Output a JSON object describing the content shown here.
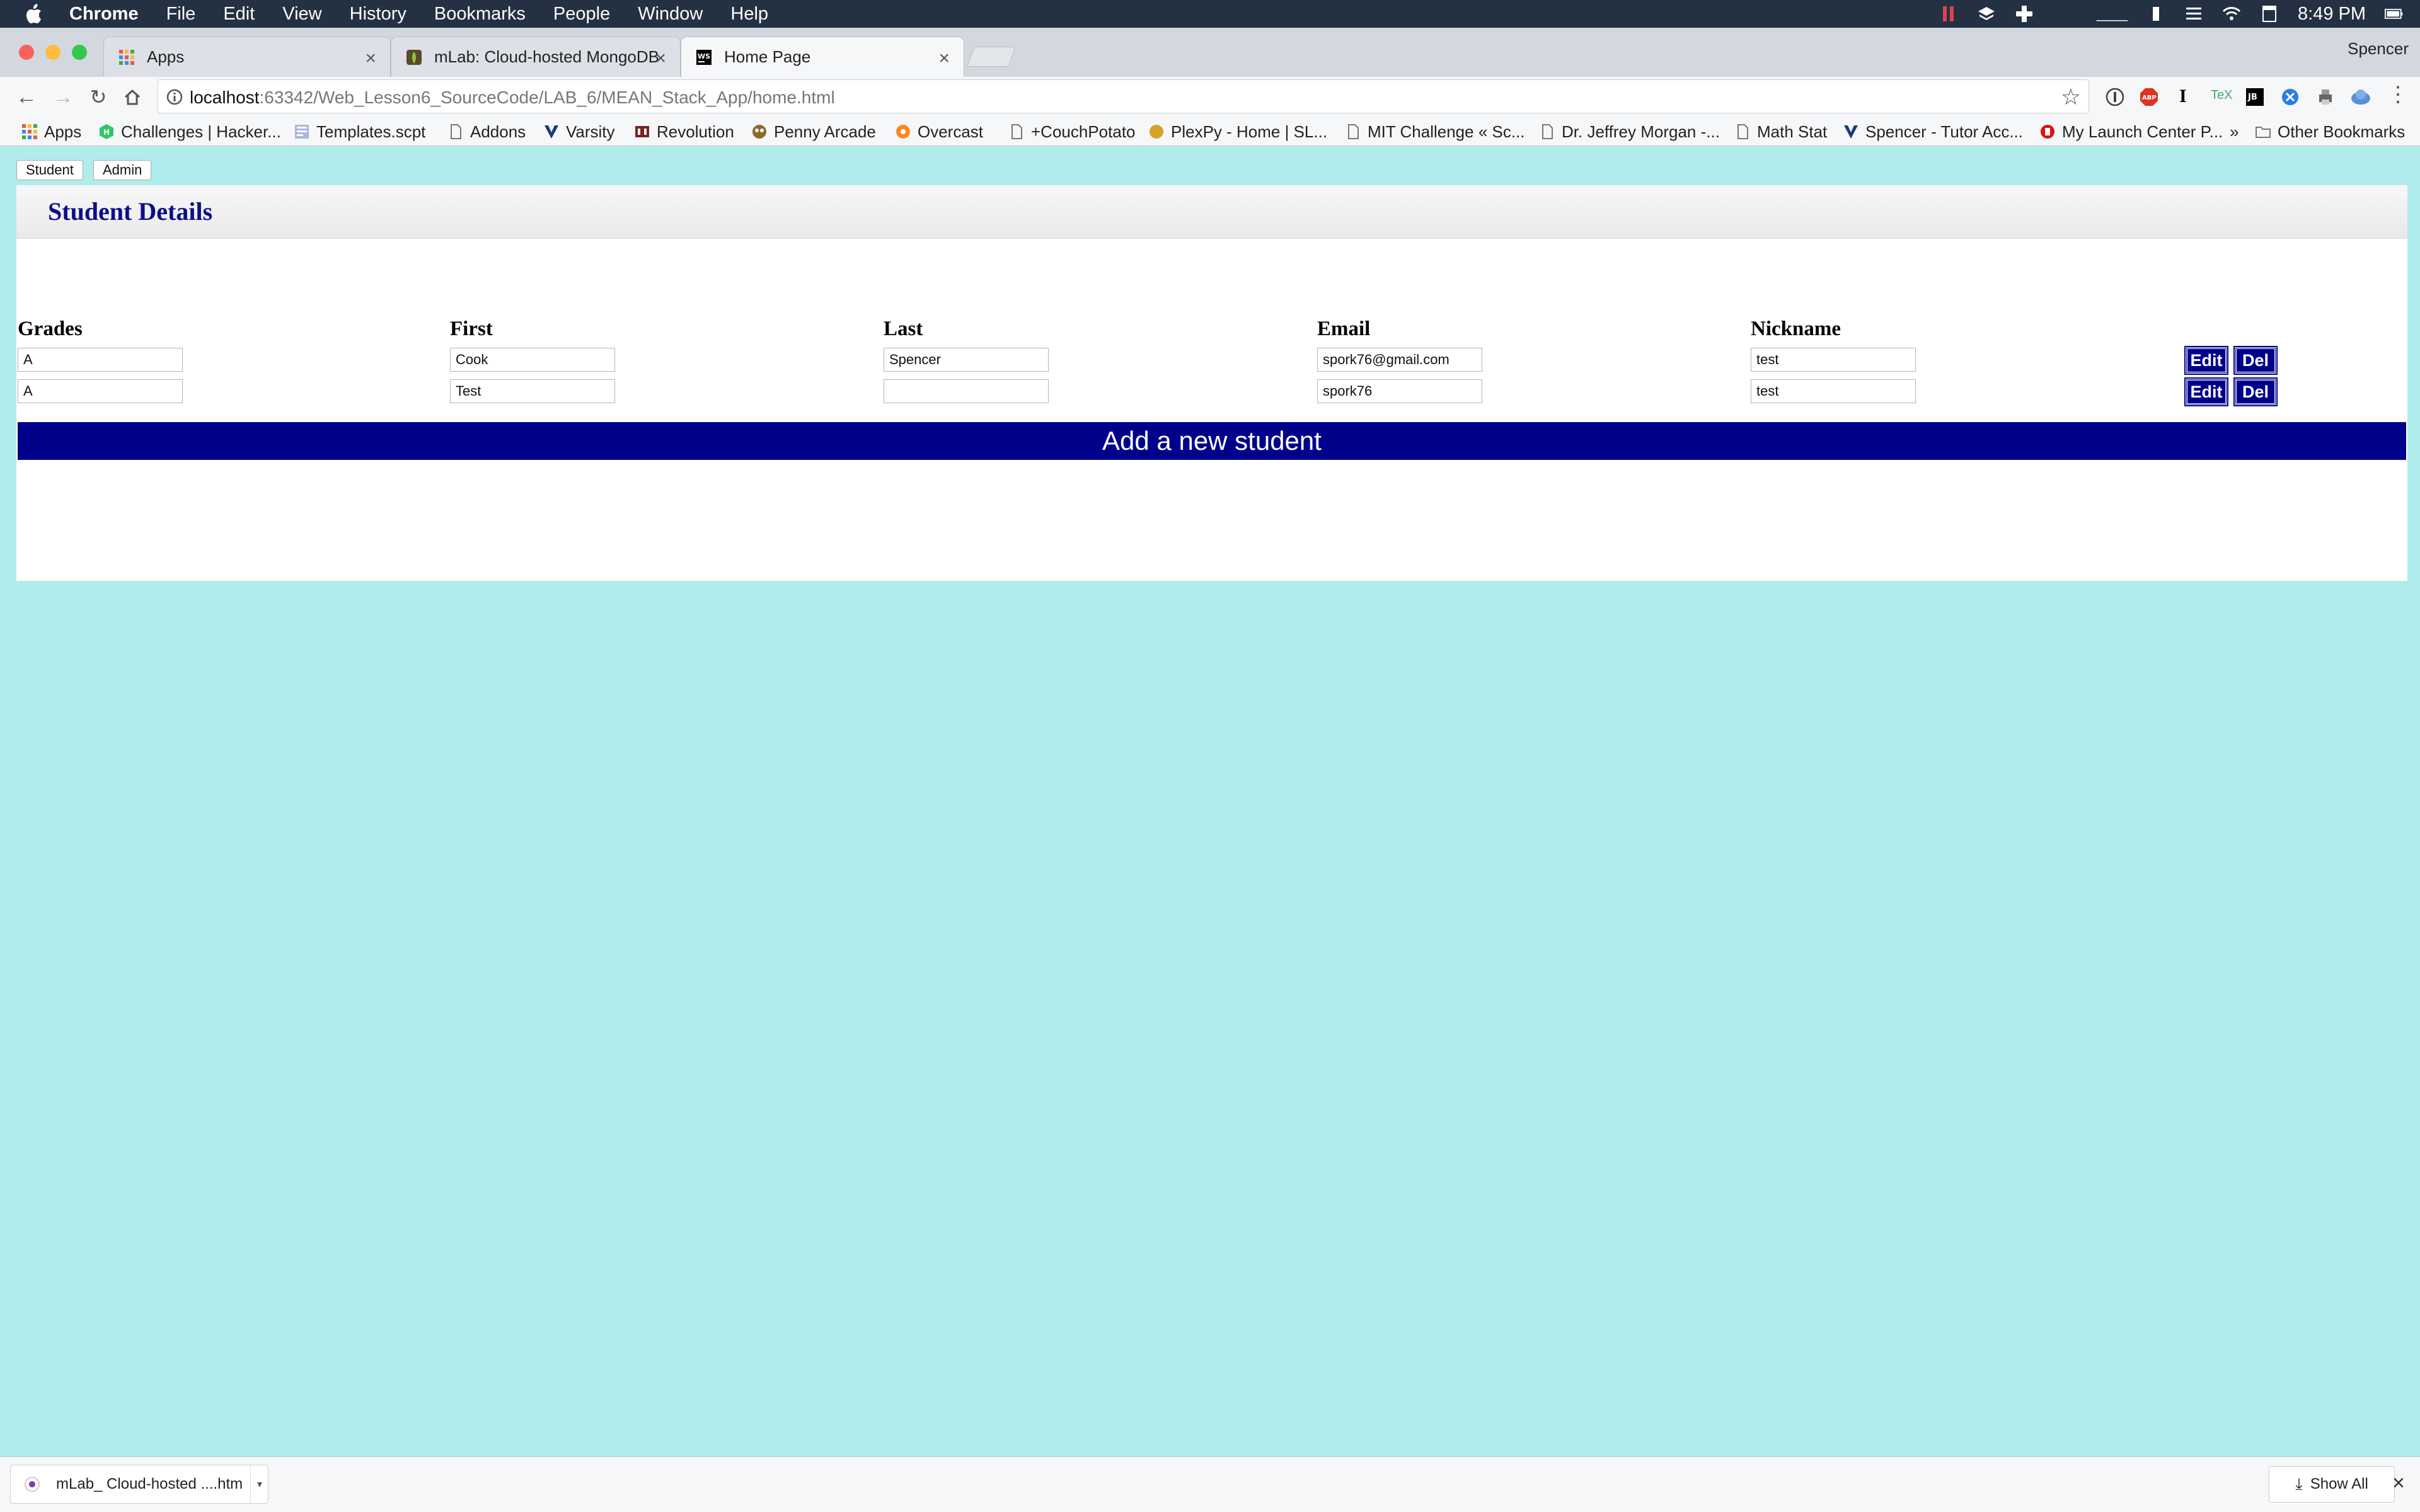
{
  "menubar": {
    "app": "Chrome",
    "items": [
      "File",
      "Edit",
      "View",
      "History",
      "Bookmarks",
      "People",
      "Window",
      "Help"
    ],
    "time": "8:49 PM",
    "status_icons": [
      "pause-icon",
      "layers-icon",
      "plus-cross-icon",
      "battery-icon",
      "wifi-icon",
      "calendar-icon",
      "battery-full-icon"
    ]
  },
  "tabs": [
    {
      "label": "Apps",
      "icon": "apps-grid-icon",
      "active": false
    },
    {
      "label": "mLab: Cloud-hosted MongoDB",
      "icon": "mlab-icon",
      "active": false
    },
    {
      "label": "Home Page",
      "icon": "webstorm-icon",
      "active": true
    }
  ],
  "profile": "Spencer",
  "url": {
    "host": "localhost",
    "path": ":63342/Web_Lesson6_SourceCode/LAB_6/MEAN_Stack_App/home.html"
  },
  "bookmarks": [
    "Apps",
    "Challenges | Hacker...",
    "Templates.scpt",
    "Addons",
    "Varsity",
    "Revolution",
    "Penny Arcade",
    "Overcast",
    "+CouchPotato",
    "PlexPy - Home | SL...",
    "MIT Challenge « Sc...",
    "Dr. Jeffrey Morgan -...",
    "Math Stat",
    "Spencer - Tutor Acc...",
    "My Launch Center P..."
  ],
  "bookmarks_more": "»",
  "bookmarks_other": "Other Bookmarks",
  "nav": {
    "student": "Student",
    "admin": "Admin"
  },
  "card_title": "Student Details",
  "columns": [
    "Grades",
    "First",
    "Last",
    "Email",
    "Nickname"
  ],
  "rows": [
    [
      "A",
      "Cook",
      "Spencer",
      "spork76@gmail.com",
      "test"
    ],
    [
      "A",
      "Test",
      "",
      "spork76",
      "test"
    ]
  ],
  "actions": {
    "edit": "Edit",
    "del": "Del"
  },
  "add_button": "Add a new student",
  "download": {
    "file": "mLab_ Cloud-hosted ....htm",
    "show_all": "Show All"
  },
  "colors": {
    "page_bg": "#b1ecec",
    "title": "#0d0d8c",
    "button_bg": "#00008b",
    "menubar": "#233143"
  }
}
